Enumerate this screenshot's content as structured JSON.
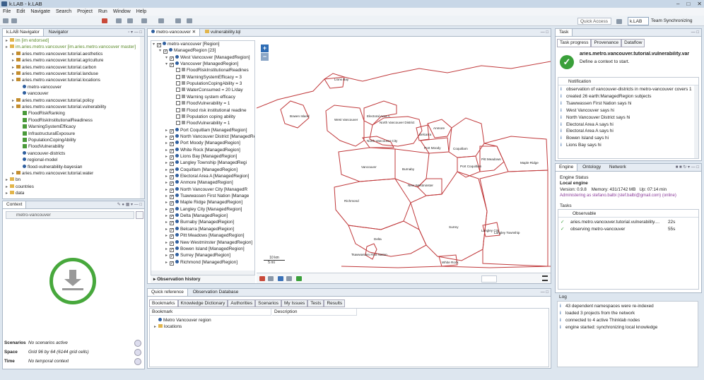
{
  "window": {
    "title": "k.LAB - k.LAB",
    "controls": [
      "–",
      "□",
      "✕"
    ]
  },
  "menu": [
    "File",
    "Edit",
    "Navigate",
    "Search",
    "Project",
    "Run",
    "Window",
    "Help"
  ],
  "toolbar": {
    "quick_access": "Quick Access",
    "perspective": "k.LAB",
    "team": "Team Synchronizing"
  },
  "navigator": {
    "tabs": [
      "k.LAB Navigator",
      "Navigator"
    ],
    "items": [
      {
        "label": "im [im endorsed]",
        "indent": 0,
        "icon": "folder",
        "color": "#5a8a2a"
      },
      {
        "label": "im.aries.metro.vancouver [im.aries.metro.vancouver master]",
        "indent": 0,
        "icon": "folder",
        "color": "#5a8a2a"
      },
      {
        "label": "aries.metro.vancouver.tutorial.aesthetics",
        "indent": 1,
        "icon": "pkg"
      },
      {
        "label": "aries.metro.vancouver.tutorial.agriculture",
        "indent": 1,
        "icon": "pkg"
      },
      {
        "label": "aries.metro.vancouver.tutorial.carbon",
        "indent": 1,
        "icon": "pkg"
      },
      {
        "label": "aries.metro.vancouver.tutorial.landuse",
        "indent": 1,
        "icon": "pkg"
      },
      {
        "label": "aries.metro.vancouver.tutorial.locations",
        "indent": 1,
        "icon": "pkg"
      },
      {
        "label": "metro-vancouver",
        "indent": 2,
        "icon": "dot"
      },
      {
        "label": "vancouver",
        "indent": 2,
        "icon": "dot"
      },
      {
        "label": "aries.metro.vancouver.tutorial.policy",
        "indent": 1,
        "icon": "pkg"
      },
      {
        "label": "aries.metro.vancouver.tutorial.vulnerability",
        "indent": 1,
        "icon": "pkg"
      },
      {
        "label": "FloodRiskRanking",
        "indent": 2,
        "icon": "gsq"
      },
      {
        "label": "FloodRiskInstitutionalReadiness",
        "indent": 2,
        "icon": "gsq"
      },
      {
        "label": "WarningSystemEfficacy",
        "indent": 2,
        "icon": "gsq"
      },
      {
        "label": "InfrastructuralExposure",
        "indent": 2,
        "icon": "gsq"
      },
      {
        "label": "PopulationCopingAbility",
        "indent": 2,
        "icon": "gsq"
      },
      {
        "label": "FloodVulnerability",
        "indent": 2,
        "icon": "gsq"
      },
      {
        "label": "vancouver-districts",
        "indent": 2,
        "icon": "dot"
      },
      {
        "label": "regional-model",
        "indent": 2,
        "icon": "dot"
      },
      {
        "label": "flood-vulnerability-bayesian",
        "indent": 2,
        "icon": "dot"
      },
      {
        "label": "aries.metro.vancouver.tutorial.water",
        "indent": 1,
        "icon": "pkg"
      },
      {
        "label": "bn",
        "indent": 0,
        "icon": "fold"
      },
      {
        "label": "countries",
        "indent": 0,
        "icon": "fold"
      },
      {
        "label": "data",
        "indent": 0,
        "icon": "fold"
      }
    ]
  },
  "context": {
    "tab": "Context",
    "field": "metro-vancouver",
    "rows": [
      {
        "label": "Scenarios",
        "value": "No scenarios active"
      },
      {
        "label": "Space",
        "value": "Grid 96 by 64 (6144 grid cells)"
      },
      {
        "label": "Time",
        "value": "No temporal context"
      }
    ]
  },
  "editor": {
    "tabs": [
      "metro-vancouver",
      "vulnerability.tql"
    ]
  },
  "region_tree": [
    {
      "label": "metro-vancouver [Region]",
      "indent": 0,
      "cb": true
    },
    {
      "label": "ManagedRegion [23]",
      "indent": 1,
      "cb": true
    },
    {
      "label": "West Vancouver [ManagedRegion]",
      "indent": 2,
      "cb": true
    },
    {
      "label": "Vancouver [ManagedRegion]",
      "indent": 2,
      "cb": true
    },
    {
      "label": "FloodRiskInstitutionalReadines",
      "indent": 3,
      "cb": false
    },
    {
      "label": "WarningSystemEfficacy = 3",
      "indent": 3,
      "cb": false
    },
    {
      "label": "PopulationCopingAbility = 3",
      "indent": 3,
      "cb": false
    },
    {
      "label": "WaterConsumed = 20 L/day",
      "indent": 3,
      "cb": false
    },
    {
      "label": "Warning system efficacy",
      "indent": 3,
      "cb": false
    },
    {
      "label": "FloodVulnerability = 1",
      "indent": 3,
      "cb": false
    },
    {
      "label": "Flood risk institutional readine",
      "indent": 3,
      "cb": false
    },
    {
      "label": "Population coping ability",
      "indent": 3,
      "cb": false
    },
    {
      "label": "FloodVulnerability = 1",
      "indent": 3,
      "cb": false
    },
    {
      "label": "Port Coquitlam [ManagedRegion]",
      "indent": 2,
      "cb": true
    },
    {
      "label": "North Vancouver District [ManagedRe",
      "indent": 2,
      "cb": true
    },
    {
      "label": "Port Moody [ManagedRegion]",
      "indent": 2,
      "cb": true
    },
    {
      "label": "White Rock [ManagedRegion]",
      "indent": 2,
      "cb": true
    },
    {
      "label": "Lions Bay [ManagedRegion]",
      "indent": 2,
      "cb": true
    },
    {
      "label": "Langley Township [ManagedRegi",
      "indent": 2,
      "cb": true
    },
    {
      "label": "Coquitlam [ManagedRegion]",
      "indent": 2,
      "cb": true
    },
    {
      "label": "Electoral Area A [ManagedRegion]",
      "indent": 2,
      "cb": true
    },
    {
      "label": "Anmore [ManagedRegion]",
      "indent": 2,
      "cb": true
    },
    {
      "label": "North Vancouver City [ManagedR",
      "indent": 2,
      "cb": true
    },
    {
      "label": "Tsawwassen First Nation [Manage",
      "indent": 2,
      "cb": true
    },
    {
      "label": "Maple Ridge [ManagedRegion]",
      "indent": 2,
      "cb": true
    },
    {
      "label": "Langley City [ManagedRegion]",
      "indent": 2,
      "cb": true
    },
    {
      "label": "Delta [ManagedRegion]",
      "indent": 2,
      "cb": true
    },
    {
      "label": "Burnaby [ManagedRegion]",
      "indent": 2,
      "cb": true
    },
    {
      "label": "Belcarra [ManagedRegion]",
      "indent": 2,
      "cb": true
    },
    {
      "label": "Pitt Meadows [ManagedRegion]",
      "indent": 2,
      "cb": true
    },
    {
      "label": "New Westminster [ManagedRegion]",
      "indent": 2,
      "cb": true
    },
    {
      "label": "Bowen Island [ManagedRegion]",
      "indent": 2,
      "cb": true
    },
    {
      "label": "Surrey [ManagedRegion]",
      "indent": 2,
      "cb": true
    },
    {
      "label": "Richmond [ManagedRegion]",
      "indent": 2,
      "cb": true
    }
  ],
  "observation_history": "Observation history",
  "map": {
    "zoom_in": "+",
    "zoom_out": "−",
    "labels": [
      "Lions Bay",
      "Bowen Island",
      "West Vancouver",
      "Electoral Area A",
      "North Vancouver District",
      "Anmore",
      "Belcarra",
      "North Vancouver City",
      "Port Moody",
      "Coquitlam",
      "Pitt Meadows",
      "Maple Ridge",
      "Vancouver",
      "Burnaby",
      "Port Coquitlam",
      "New Westminster",
      "Richmond",
      "Surrey",
      "Langley City",
      "Langley Township",
      "Delta",
      "Tsawwassen First Nation",
      "White Rock"
    ],
    "scale": [
      "10 km",
      "5 mi"
    ],
    "border_color": "#c0393b"
  },
  "quickref": {
    "tabs": [
      "Quick reference",
      "Observation Database"
    ],
    "subtabs": [
      "Bookmarks",
      "Knowledge Dictionary",
      "Authorities",
      "Scenarios",
      "My Issues",
      "Tests",
      "Results"
    ],
    "columns": [
      "Bookmark",
      "Description"
    ],
    "rows": [
      "Metro Vancouver region",
      "locations"
    ]
  },
  "task": {
    "tab": "Task",
    "subtabs": [
      "Task progress",
      "Provenance",
      "Dataflow"
    ],
    "title": "aries.metro.vancouver.tutorial.vulnerability.var",
    "subtitle": "Define a context to start.",
    "notif_header": "Notification",
    "notifications": [
      "observation of vancouver-districts in metro-vancouver covers 1",
      "created 26 earth:ManagedRegion subjects",
      "Tsawwassen First Nation says hi",
      "West Vancouver says hi",
      "North Vancouver District says hi",
      "Electoral Area A says hi",
      "Electoral Area A says hi",
      "Bowen Island says hi",
      "Lions Bay says hi"
    ]
  },
  "engine": {
    "tabs": [
      "Engine",
      "Ontology",
      "Network"
    ],
    "status_label": "Engine Status",
    "local": "Local engine",
    "version": "Version: 0.9.8",
    "memory": "Memory: 431/1742 MB",
    "uptime": "Up: 07:14 min",
    "admin": "Administering as stefano.balbi (stef.balbi@gmail.com) (online)",
    "tasks_label": "Tasks",
    "tasks_header": "Observable",
    "tasks": [
      {
        "name": "aries.metro.vancouver.tutorial.vulnerability....",
        "time": "22s"
      },
      {
        "name": "observing metro-vancouver",
        "time": "55s"
      }
    ],
    "log_label": "Log",
    "log": [
      "43 dependent namespaces were re-indexed",
      "loaded 3 projects from the network",
      "connected to 4 active Thinklab nodes",
      "engine started: synchronizing local knowledge"
    ]
  },
  "colors": {
    "accent": "#2f6db5",
    "check": "#3aa03a",
    "map_border": "#c0393b"
  }
}
